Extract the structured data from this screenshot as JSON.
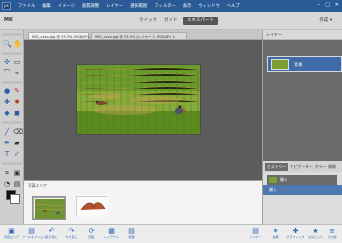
{
  "app": {
    "logo": "ps",
    "menus": [
      "ファイル",
      "編集",
      "イメージ",
      "画質調整",
      "レイヤー",
      "選択範囲",
      "フィルター",
      "表示",
      "ウィンドウ",
      "ヘルプ"
    ],
    "window_controls": [
      "–",
      "□",
      "✕"
    ]
  },
  "modebar": {
    "left_label": "MK",
    "tabs": [
      "クイック",
      "ガイド",
      "エキスパート"
    ],
    "right_label": "作成 ▾"
  },
  "document_tabs": [
    {
      "label": "IMG_xxxx.jpg @ 33.3% (RGB/8*) ✕",
      "active": true
    },
    {
      "label": "IMG_xxxx.jpg @ 33.3% (レイヤー 1, RGB/8*) ✕",
      "active": false
    }
  ],
  "rightpanel": {
    "top_label": "レイヤー",
    "layer_name": "背景",
    "lower_tabs": [
      "ヒストリー",
      "ナビゲーター",
      "カラー",
      "情報"
    ],
    "history_items": [
      "開く",
      "開く"
    ]
  },
  "filmstrip": {
    "label": "写真エリア"
  },
  "bottombar": {
    "left_buttons": [
      "写真エリア",
      "ツールオプション",
      "取り消し",
      "やり直し",
      "回転",
      "レイアウト",
      "整理"
    ],
    "right_buttons": [
      "レイヤー",
      "効果",
      "グラフィック",
      "お気に入り",
      "その他"
    ]
  }
}
